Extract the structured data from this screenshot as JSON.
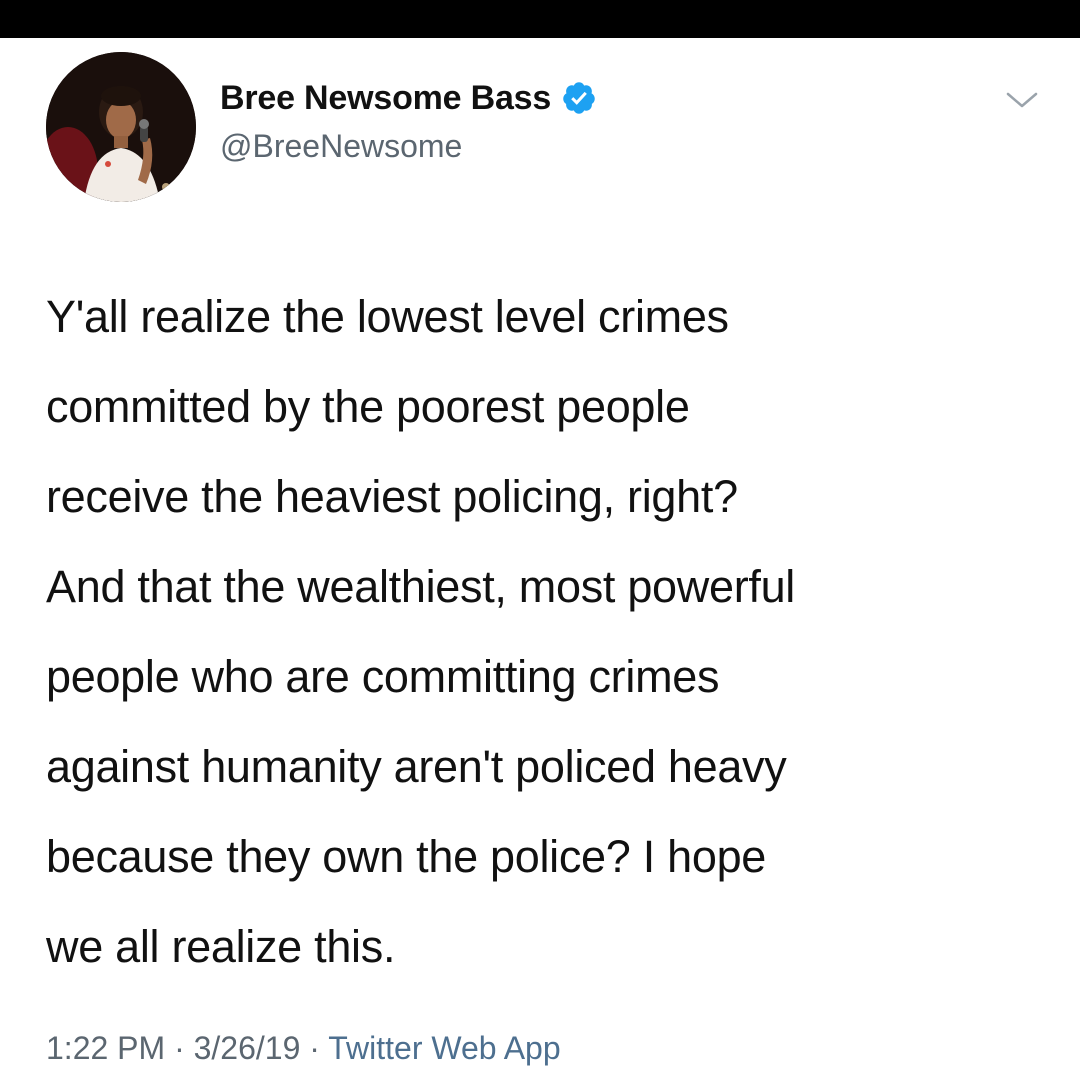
{
  "header": {
    "display_name": "Bree Newsome Bass",
    "handle": "@BreeNewsome",
    "verified": true
  },
  "tweet": {
    "lines": [
      "Y'all realize the lowest level crimes",
      "committed by the poorest people",
      "receive the heaviest policing, right?",
      "And that the wealthiest, most powerful",
      "people who are committing crimes",
      "against humanity aren't policed heavy",
      "because they own the police? I hope",
      "we all realize this."
    ]
  },
  "meta": {
    "time": "1:22 PM",
    "separator": " · ",
    "date": "3/26/19",
    "source": "Twitter Web App"
  },
  "icons": {
    "verified": "verified-badge-icon",
    "menu": "chevron-down-icon",
    "avatar": "profile-photo"
  },
  "colors": {
    "verified_blue": "#1da1f2",
    "link_blue": "#4d6f8f",
    "secondary_text": "#5b6670",
    "primary_text": "#111111"
  }
}
